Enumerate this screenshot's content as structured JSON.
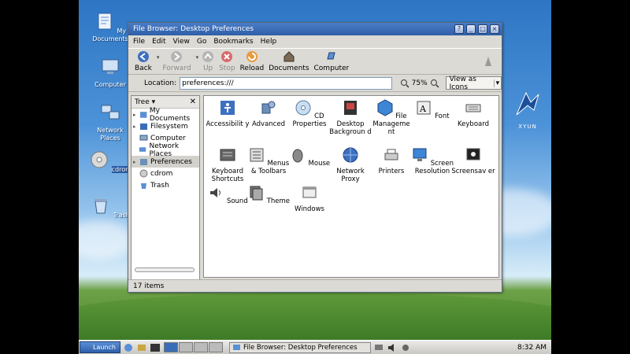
{
  "desktop": {
    "icons": [
      {
        "label": "My Documents"
      },
      {
        "label": "Computer"
      },
      {
        "label": "Network Places"
      },
      {
        "label": "cdrom"
      },
      {
        "label": "Trash"
      }
    ],
    "logo_text": "XYUN"
  },
  "window": {
    "title": "File Browser: Desktop Preferences",
    "buttons": [
      "?",
      "_",
      "□",
      "×"
    ],
    "menu": [
      "File",
      "Edit",
      "View",
      "Go",
      "Bookmarks",
      "Help"
    ],
    "toolbar": {
      "back": "Back",
      "forward": "Forward",
      "up": "Up",
      "stop": "Stop",
      "reload": "Reload",
      "documents": "Documents",
      "computer": "Computer"
    },
    "location": {
      "label": "Location:",
      "value": "preferences:///",
      "zoom": "75%",
      "view_mode": "View as Icons"
    },
    "sidebar": {
      "header": "Tree",
      "items": [
        {
          "label": "My Documents"
        },
        {
          "label": "Filesystem"
        },
        {
          "label": "Computer"
        },
        {
          "label": "Network Places"
        },
        {
          "label": "Preferences"
        },
        {
          "label": "cdrom"
        },
        {
          "label": "Trash"
        }
      ]
    },
    "items": [
      {
        "label": "Accessibilit y"
      },
      {
        "label": "Advanced"
      },
      {
        "label": "CD Properties"
      },
      {
        "label": "Desktop Backgroun d"
      },
      {
        "label": "File Manageme nt"
      },
      {
        "label": "Font"
      },
      {
        "label": "Keyboard"
      },
      {
        "label": "Keyboard Shortcuts"
      },
      {
        "label": "Menus & Toolbars"
      },
      {
        "label": "Mouse"
      },
      {
        "label": "Network Proxy"
      },
      {
        "label": "Printers"
      },
      {
        "label": "Screen Resolution"
      },
      {
        "label": "Screensav er"
      },
      {
        "label": "Sound"
      },
      {
        "label": "Theme"
      },
      {
        "label": "Windows"
      }
    ],
    "status": "17 items"
  },
  "taskbar": {
    "start_label": "Launch",
    "task": "File Browser: Desktop Preferences",
    "clock": "8:32 AM"
  }
}
